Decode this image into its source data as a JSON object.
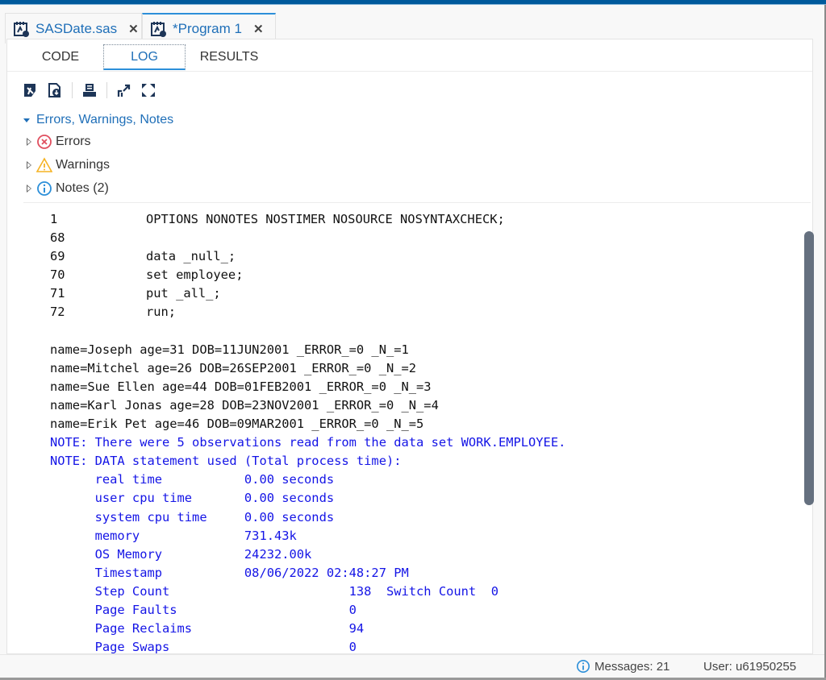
{
  "file_tabs": [
    {
      "label": "SASDate.sas",
      "icon": "sas-program-icon",
      "active": false
    },
    {
      "label": "*Program 1",
      "icon": "sas-program-icon",
      "active": true
    }
  ],
  "close_glyph": "✕",
  "sub_tabs": [
    {
      "label": "CODE",
      "active": false
    },
    {
      "label": "LOG",
      "active": true
    },
    {
      "label": "RESULTS",
      "active": false
    }
  ],
  "toolbar": {
    "buttons": [
      "save-log-icon",
      "download-log-icon",
      "print-icon",
      "open-in-window-icon",
      "maximize-icon"
    ]
  },
  "tree": {
    "header": "Errors, Warnings, Notes",
    "items": [
      {
        "label": "Errors",
        "icon": "error-icon",
        "color": "#e04f5f"
      },
      {
        "label": "Warnings",
        "icon": "warning-icon",
        "color": "#f5b324"
      },
      {
        "label": "Notes (2)",
        "icon": "info-icon",
        "color": "#2c8fd9"
      }
    ]
  },
  "log": {
    "source_lines": [
      {
        "num": "1",
        "code": "OPTIONS NONOTES NOSTIMER NOSOURCE NOSYNTAXCHECK;"
      },
      {
        "num": "68",
        "code": ""
      },
      {
        "num": "69",
        "code": "data _null_;"
      },
      {
        "num": "70",
        "code": "set employee;"
      },
      {
        "num": "71",
        "code": "put _all_;"
      },
      {
        "num": "72",
        "code": "run;"
      }
    ],
    "output_lines": [
      "name=Joseph age=31 DOB=11JUN2001 _ERROR_=0 _N_=1",
      "name=Mitchel age=26 DOB=26SEP2001 _ERROR_=0 _N_=2",
      "name=Sue Ellen age=44 DOB=01FEB2001 _ERROR_=0 _N_=3",
      "name=Karl Jonas age=28 DOB=23NOV2001 _ERROR_=0 _N_=4",
      "name=Erik Pet age=46 DOB=09MAR2001 _ERROR_=0 _N_=5"
    ],
    "note_lines": [
      "NOTE: There were 5 observations read from the data set WORK.EMPLOYEE.",
      "NOTE: DATA statement used (Total process time):",
      "      real time           0.00 seconds",
      "      user cpu time       0.00 seconds",
      "      system cpu time     0.00 seconds",
      "      memory              731.43k",
      "      OS Memory           24232.00k",
      "      Timestamp           08/06/2022 02:48:27 PM",
      "      Step Count                        138  Switch Count  0",
      "      Page Faults                       0",
      "      Page Reclaims                     94",
      "      Page Swaps                        0"
    ],
    "note_color": "#1414e6"
  },
  "status": {
    "messages": "Messages: 21",
    "user": "User: u61950255"
  }
}
